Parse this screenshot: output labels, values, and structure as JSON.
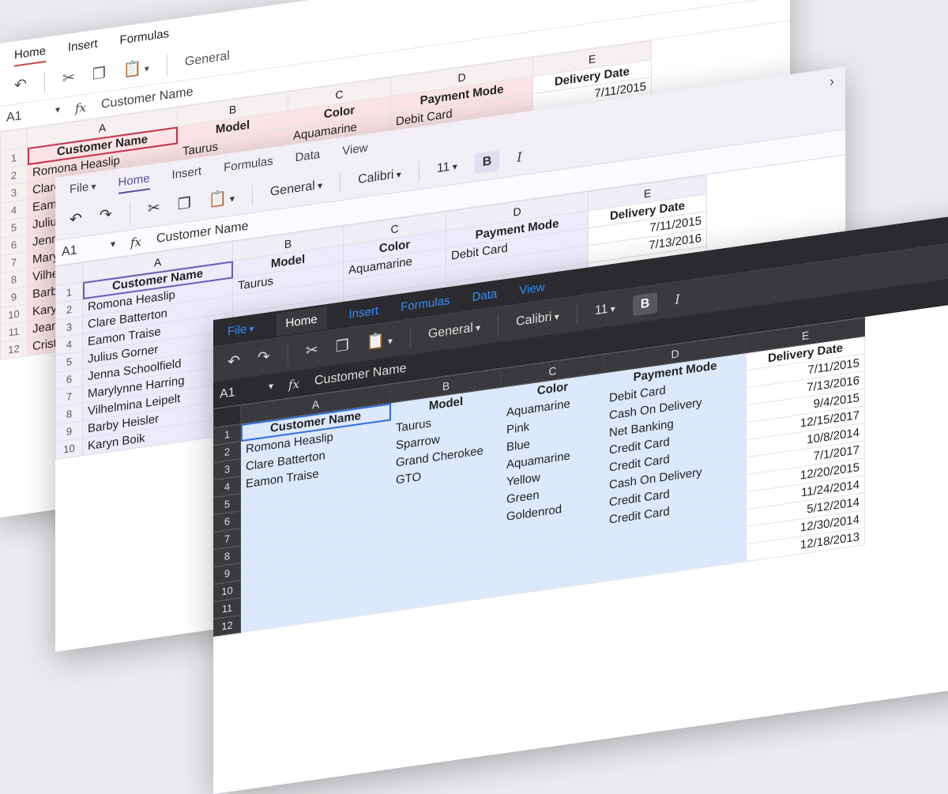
{
  "back": {
    "tabs": [
      "Home",
      "Insert",
      "Formulas"
    ],
    "number_format": "General",
    "name_box": "A1",
    "formula_value": "Customer Name",
    "columns": [
      "A",
      "B",
      "C",
      "D",
      "E"
    ],
    "headers": [
      "Customer Name",
      "Model",
      "Color",
      "Payment Mode",
      "Delivery Date"
    ],
    "rows": [
      [
        "Romona Heaslip",
        "Taurus",
        "Aquamarine",
        "Debit Card",
        "7/11/2015"
      ],
      [
        "Clare Batterton",
        "Sparrow",
        "Pink",
        "Cash On Delivery",
        "7/13/2016"
      ],
      [
        "Eamon Traise",
        "Grand Cherokee",
        "Blue",
        "Net Banking",
        "9/4/2015"
      ],
      [
        "Julius Gorner",
        "",
        "",
        "",
        ""
      ],
      [
        "Jenna Schoolfield",
        "",
        "",
        "",
        ""
      ],
      [
        "Marylynne Harring",
        "",
        "",
        "",
        ""
      ],
      [
        "Vilhelmina Leipelt",
        "",
        "",
        "",
        ""
      ],
      [
        "Barby Heisler",
        "",
        "",
        "",
        ""
      ],
      [
        "Karyn Boik",
        "",
        "",
        "",
        ""
      ],
      [
        "Jeanette Pamplin",
        "",
        "",
        "",
        ""
      ],
      [
        "Cristi Espinos",
        "",
        "",
        "",
        ""
      ]
    ]
  },
  "mid": {
    "menu_file": "File",
    "tabs": [
      "Home",
      "Insert",
      "Formulas",
      "Data",
      "View"
    ],
    "number_format": "General",
    "font_name": "Calibri",
    "font_size": "11",
    "bold": "B",
    "italic": "I",
    "name_box": "A1",
    "formula_value": "Customer Name",
    "columns": [
      "A",
      "B",
      "C",
      "D",
      "E"
    ],
    "headers": [
      "Customer Name",
      "Model",
      "Color",
      "Payment Mode",
      "Delivery Date"
    ],
    "rows": [
      [
        "Romona Heaslip",
        "Taurus",
        "Aquamarine",
        "Debit Card",
        "7/11/2015"
      ],
      [
        "Clare Batterton",
        "",
        "",
        "",
        "7/13/2016"
      ],
      [
        "Eamon Traise",
        "",
        "",
        "",
        ""
      ],
      [
        "Julius Gorner",
        "",
        "",
        "",
        ""
      ],
      [
        "Jenna Schoolfield",
        "",
        "",
        "",
        ""
      ],
      [
        "Marylynne Harring",
        "",
        "",
        "",
        ""
      ],
      [
        "Vilhelmina Leipelt",
        "",
        "",
        "",
        ""
      ],
      [
        "Barby Heisler",
        "",
        "",
        "",
        ""
      ],
      [
        "Karyn Boik",
        "",
        "",
        "",
        ""
      ]
    ]
  },
  "front": {
    "menu_file": "File",
    "tabs": [
      "Home",
      "Insert",
      "Formulas",
      "Data",
      "View"
    ],
    "number_format": "General",
    "font_name": "Calibri",
    "font_size": "11",
    "bold": "B",
    "italic": "I",
    "name_box": "A1",
    "formula_value": "Customer Name",
    "columns": [
      "A",
      "B",
      "C",
      "D",
      "E"
    ],
    "headers": [
      "Customer Name",
      "Model",
      "Color",
      "Payment Mode",
      "Delivery Date"
    ],
    "rows": [
      [
        "Romona Heaslip",
        "Taurus",
        "Aquamarine",
        "Debit Card",
        "7/11/2015"
      ],
      [
        "Clare Batterton",
        "Sparrow",
        "Pink",
        "Cash On Delivery",
        "7/13/2016"
      ],
      [
        "Eamon Traise",
        "Grand Cherokee",
        "Blue",
        "Net Banking",
        "9/4/2015"
      ],
      [
        "",
        "GTO",
        "Aquamarine",
        "Credit Card",
        "12/15/2017"
      ],
      [
        "",
        "",
        "Yellow",
        "Credit Card",
        "10/8/2014"
      ],
      [
        "",
        "",
        "Green",
        "Cash On Delivery",
        "7/1/2017"
      ],
      [
        "",
        "",
        "Goldenrod",
        "Credit Card",
        "12/20/2015"
      ],
      [
        "",
        "",
        "",
        "Credit Card",
        "11/24/2014"
      ],
      [
        "",
        "",
        "",
        "",
        "5/12/2014"
      ],
      [
        "",
        "",
        "",
        "",
        "12/30/2014"
      ],
      [
        "",
        "",
        "",
        "",
        "12/18/2013"
      ]
    ]
  },
  "icons": [
    "cut-icon",
    "copy-icon",
    "paste-icon",
    "undo-icon",
    "redo-icon",
    "chevron-right-icon",
    "chevron-up-icon",
    "chevron-down-icon",
    "add-sheet-icon",
    "sheet-menu-icon"
  ]
}
